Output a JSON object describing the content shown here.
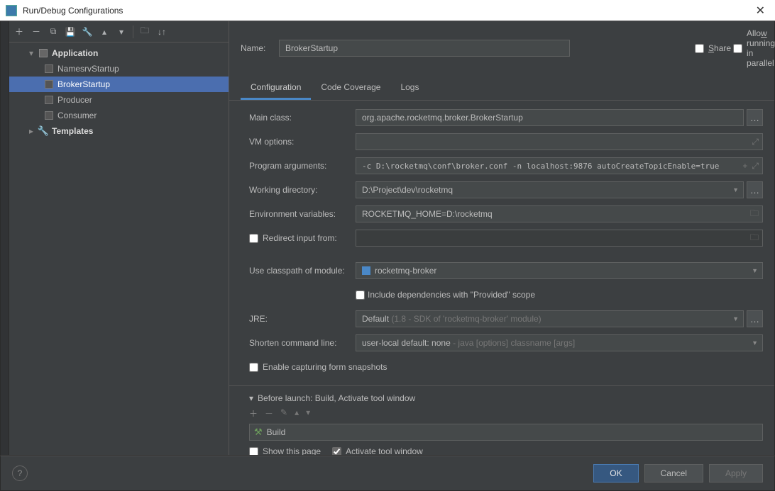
{
  "window": {
    "title": "Run/Debug Configurations"
  },
  "sidebar": {
    "items": [
      {
        "label": "Application",
        "children": [
          {
            "label": "NamesrvStartup"
          },
          {
            "label": "BrokerStartup",
            "selected": true
          },
          {
            "label": "Producer"
          },
          {
            "label": "Consumer"
          }
        ]
      },
      {
        "label": "Templates"
      }
    ]
  },
  "header": {
    "name_label": "Name:",
    "name_value": "BrokerStartup",
    "share": "Share",
    "parallel": "Allow running in parallel"
  },
  "tabs": [
    {
      "label": "Configuration",
      "active": true
    },
    {
      "label": "Code Coverage"
    },
    {
      "label": "Logs"
    }
  ],
  "form": {
    "main_class_label": "Main class:",
    "main_class_value": "org.apache.rocketmq.broker.BrokerStartup",
    "vm_label": "VM options:",
    "vm_value": "",
    "args_label": "Program arguments:",
    "args_value": "-c D:\\rocketmq\\conf\\broker.conf -n localhost:9876 autoCreateTopicEnable=true",
    "cwd_label": "Working directory:",
    "cwd_value": "D:\\Project\\dev\\rocketmq",
    "env_label": "Environment variables:",
    "env_value": "ROCKETMQ_HOME=D:\\rocketmq",
    "redirect_label": "Redirect input from:",
    "classpath_label": "Use classpath of module:",
    "classpath_value": "rocketmq-broker",
    "include_provided": "Include dependencies with \"Provided\" scope",
    "jre_label": "JRE:",
    "jre_value_prefix": "Default ",
    "jre_value_muted": "(1.8 - SDK of 'rocketmq-broker' module)",
    "shorten_label": "Shorten command line:",
    "shorten_value_prefix": "user-local default: none",
    "shorten_value_muted": " - java [options] classname [args]",
    "enable_snapshots": "Enable capturing form snapshots"
  },
  "before_launch": {
    "title": "Before launch: Build, Activate tool window",
    "build": "Build",
    "show_page": "Show this page",
    "activate": "Activate tool window"
  },
  "buttons": {
    "ok": "OK",
    "cancel": "Cancel",
    "apply": "Apply"
  }
}
